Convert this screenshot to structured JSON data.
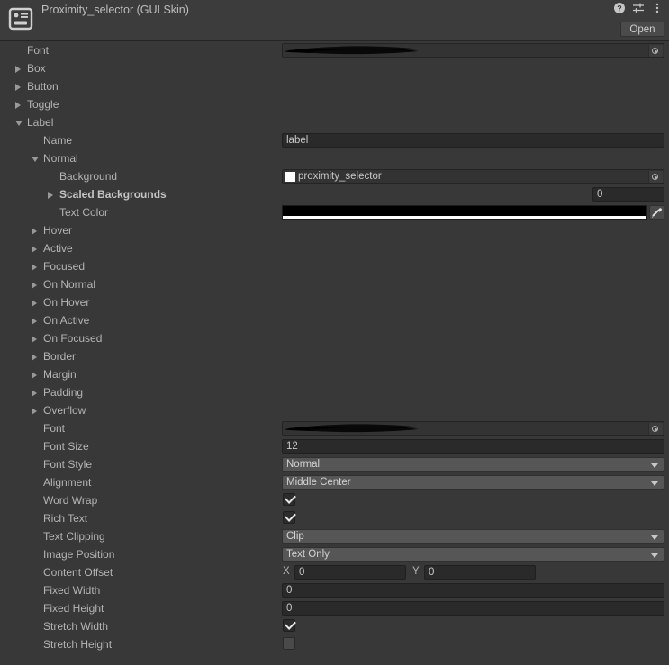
{
  "header": {
    "title": "Proximity_selector (GUI Skin)",
    "icon": "gui-skin-asset-icon",
    "help_icon": "help-icon",
    "settings_icon": "settings-sliders-icon",
    "menu_icon": "kebab-menu-icon",
    "open_label": "Open"
  },
  "colors": {
    "window_bg": "#383838",
    "header_bg": "#3c3c3c",
    "input_bg": "#2a2a2a",
    "dropdown_bg": "#565656",
    "text": "#b4b4b4",
    "text_color_value": "#000000",
    "thumbnail": "#ffffff"
  },
  "rows": [
    {
      "label": "Font",
      "indent": 0,
      "foldout": "none",
      "field": "object-redacted"
    },
    {
      "label": "Box",
      "indent": 0,
      "foldout": "closed",
      "field": "none"
    },
    {
      "label": "Button",
      "indent": 0,
      "foldout": "closed",
      "field": "none"
    },
    {
      "label": "Toggle",
      "indent": 0,
      "foldout": "closed",
      "field": "none"
    },
    {
      "label": "Label",
      "indent": 0,
      "foldout": "open",
      "field": "none"
    },
    {
      "label": "Name",
      "indent": 1,
      "foldout": "none",
      "field": "text",
      "value": "label"
    },
    {
      "label": "Normal",
      "indent": 1,
      "foldout": "open",
      "field": "none"
    },
    {
      "label": "Background",
      "indent": 2,
      "foldout": "none",
      "field": "object",
      "value": "proximity_selector"
    },
    {
      "label": "Scaled Backgrounds",
      "indent": 2,
      "foldout": "closed",
      "bold": true,
      "field": "size",
      "value": "0"
    },
    {
      "label": "Text Color",
      "indent": 2,
      "foldout": "none",
      "field": "color",
      "value": "#000000"
    },
    {
      "label": "Hover",
      "indent": 1,
      "foldout": "closed",
      "field": "none"
    },
    {
      "label": "Active",
      "indent": 1,
      "foldout": "closed",
      "field": "none"
    },
    {
      "label": "Focused",
      "indent": 1,
      "foldout": "closed",
      "field": "none"
    },
    {
      "label": "On Normal",
      "indent": 1,
      "foldout": "closed",
      "field": "none"
    },
    {
      "label": "On Hover",
      "indent": 1,
      "foldout": "closed",
      "field": "none"
    },
    {
      "label": "On Active",
      "indent": 1,
      "foldout": "closed",
      "field": "none"
    },
    {
      "label": "On Focused",
      "indent": 1,
      "foldout": "closed",
      "field": "none"
    },
    {
      "label": "Border",
      "indent": 1,
      "foldout": "closed",
      "field": "none"
    },
    {
      "label": "Margin",
      "indent": 1,
      "foldout": "closed",
      "field": "none"
    },
    {
      "label": "Padding",
      "indent": 1,
      "foldout": "closed",
      "field": "none"
    },
    {
      "label": "Overflow",
      "indent": 1,
      "foldout": "closed",
      "field": "none"
    },
    {
      "label": "Font",
      "indent": 1,
      "foldout": "none",
      "field": "object-redacted"
    },
    {
      "label": "Font Size",
      "indent": 1,
      "foldout": "none",
      "field": "text",
      "value": "12"
    },
    {
      "label": "Font Style",
      "indent": 1,
      "foldout": "none",
      "field": "dropdown",
      "value": "Normal"
    },
    {
      "label": "Alignment",
      "indent": 1,
      "foldout": "none",
      "field": "dropdown",
      "value": "Middle Center"
    },
    {
      "label": "Word Wrap",
      "indent": 1,
      "foldout": "none",
      "field": "checkbox",
      "checked": true
    },
    {
      "label": "Rich Text",
      "indent": 1,
      "foldout": "none",
      "field": "checkbox",
      "checked": true
    },
    {
      "label": "Text Clipping",
      "indent": 1,
      "foldout": "none",
      "field": "dropdown",
      "value": "Clip"
    },
    {
      "label": "Image Position",
      "indent": 1,
      "foldout": "none",
      "field": "dropdown",
      "value": "Text Only"
    },
    {
      "label": "Content Offset",
      "indent": 1,
      "foldout": "none",
      "field": "vector2",
      "x_label": "X",
      "x_value": "0",
      "y_label": "Y",
      "y_value": "0"
    },
    {
      "label": "Fixed Width",
      "indent": 1,
      "foldout": "none",
      "field": "text",
      "value": "0"
    },
    {
      "label": "Fixed Height",
      "indent": 1,
      "foldout": "none",
      "field": "text",
      "value": "0"
    },
    {
      "label": "Stretch Width",
      "indent": 1,
      "foldout": "none",
      "field": "checkbox",
      "checked": true
    },
    {
      "label": "Stretch Height",
      "indent": 1,
      "foldout": "none",
      "field": "checkbox",
      "checked": false
    }
  ]
}
